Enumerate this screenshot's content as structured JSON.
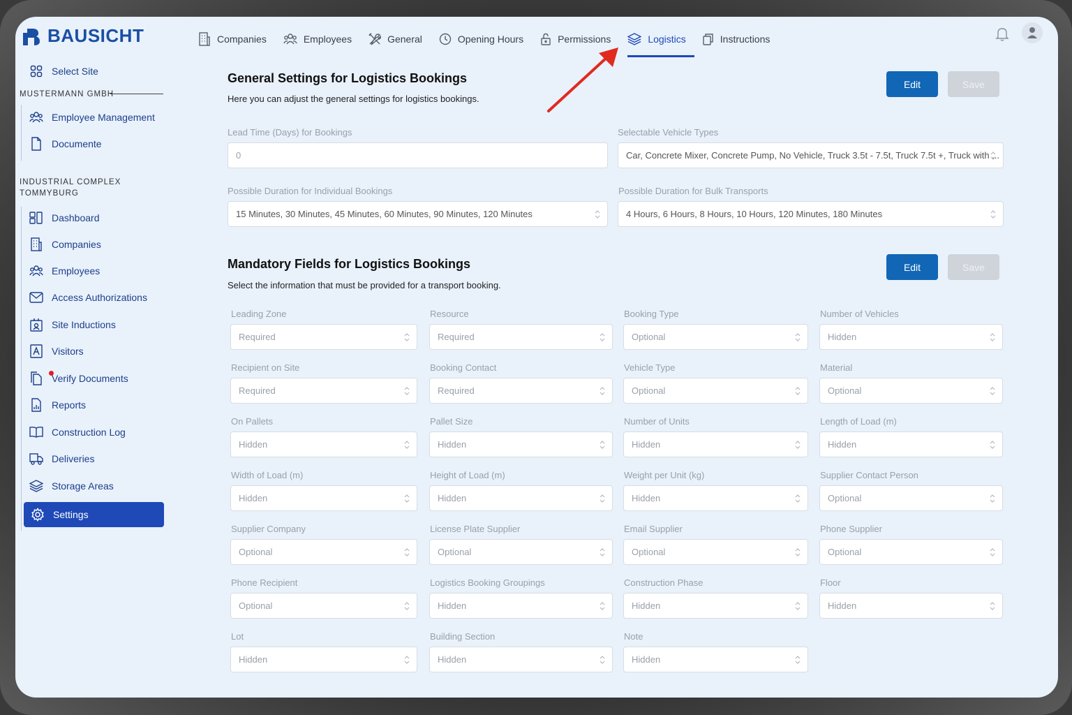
{
  "brand": {
    "name": "BAUSICHT",
    "color": "#1a4fa3"
  },
  "colors": {
    "accent": "#1e49b7",
    "primary_button": "#1166b5",
    "alert_dot": "#e11d2a"
  },
  "sidebar": {
    "select_site": "Select Site",
    "org_label": "MUSTERMANN GMBH",
    "org_items": [
      {
        "label": "Employee Management",
        "icon": "people-icon"
      },
      {
        "label": "Documente",
        "icon": "document-icon"
      }
    ],
    "site_label_1": "INDUSTRIAL COMPLEX",
    "site_label_2": "TOMMYBURG",
    "site_items": [
      {
        "label": "Dashboard",
        "icon": "dashboard-icon"
      },
      {
        "label": "Companies",
        "icon": "building-icon"
      },
      {
        "label": "Employees",
        "icon": "people-icon"
      },
      {
        "label": "Access Authorizations",
        "icon": "mail-icon"
      },
      {
        "label": "Site Inductions",
        "icon": "induction-icon"
      },
      {
        "label": "Visitors",
        "icon": "visitor-icon"
      },
      {
        "label": "Verify Documents",
        "icon": "documents-icon"
      },
      {
        "label": "Reports",
        "icon": "report-icon"
      },
      {
        "label": "Construction Log",
        "icon": "book-icon"
      },
      {
        "label": "Deliveries",
        "icon": "truck-icon"
      },
      {
        "label": "Storage Areas",
        "icon": "layers-icon"
      },
      {
        "label": "Settings",
        "icon": "gear-icon"
      }
    ]
  },
  "topnav": {
    "tabs": [
      {
        "label": "Companies",
        "icon": "building-icon"
      },
      {
        "label": "Employees",
        "icon": "people-icon"
      },
      {
        "label": "General",
        "icon": "tools-icon"
      },
      {
        "label": "Opening Hours",
        "icon": "clock-icon"
      },
      {
        "label": "Permissions",
        "icon": "lock-icon"
      },
      {
        "label": "Logistics",
        "icon": "layers-icon"
      },
      {
        "label": "Instructions",
        "icon": "clipboard-icon"
      }
    ],
    "active_tab": "Logistics"
  },
  "general_settings": {
    "title": "General Settings for Logistics Bookings",
    "subtitle": "Here you can adjust the general settings for logistics bookings.",
    "edit_label": "Edit",
    "save_label": "Save",
    "lead_time_label": "Lead Time (Days) for Bookings",
    "lead_time_value": "0",
    "vehicle_types_label": "Selectable Vehicle Types",
    "vehicle_types_value": "Car, Concrete Mixer, Concrete Pump, No Vehicle, Truck 3.5t - 7.5t, Truck 7.5t +, Truck with ...",
    "individual_label": "Possible Duration for Individual Bookings",
    "individual_value": "15 Minutes, 30 Minutes, 45 Minutes, 60 Minutes, 90 Minutes, 120 Minutes",
    "bulk_label": "Possible Duration for Bulk Transports",
    "bulk_value": "4 Hours, 6 Hours, 8 Hours, 10 Hours, 120 Minutes, 180 Minutes"
  },
  "mandatory_fields": {
    "title": "Mandatory Fields for Logistics Bookings",
    "subtitle": "Select the information that must be provided for a transport booking.",
    "edit_label": "Edit",
    "save_label": "Save",
    "fields": [
      {
        "label": "Leading Zone",
        "value": "Required"
      },
      {
        "label": "Resource",
        "value": "Required"
      },
      {
        "label": "Booking Type",
        "value": "Optional"
      },
      {
        "label": "Number of Vehicles",
        "value": "Hidden"
      },
      {
        "label": "Recipient on Site",
        "value": "Required"
      },
      {
        "label": "Booking Contact",
        "value": "Required"
      },
      {
        "label": "Vehicle Type",
        "value": "Optional"
      },
      {
        "label": "Material",
        "value": "Optional"
      },
      {
        "label": "On Pallets",
        "value": "Hidden"
      },
      {
        "label": "Pallet Size",
        "value": "Hidden"
      },
      {
        "label": "Number of Units",
        "value": "Hidden"
      },
      {
        "label": "Length of Load (m)",
        "value": "Hidden"
      },
      {
        "label": "Width of Load (m)",
        "value": "Hidden"
      },
      {
        "label": "Height of Load (m)",
        "value": "Hidden"
      },
      {
        "label": "Weight per Unit (kg)",
        "value": "Hidden"
      },
      {
        "label": "Supplier Contact Person",
        "value": "Optional"
      },
      {
        "label": "Supplier Company",
        "value": "Optional"
      },
      {
        "label": "License Plate Supplier",
        "value": "Optional"
      },
      {
        "label": "Email Supplier",
        "value": "Optional"
      },
      {
        "label": "Phone Supplier",
        "value": "Optional"
      },
      {
        "label": "Phone Recipient",
        "value": "Optional"
      },
      {
        "label": "Logistics Booking Groupings",
        "value": "Hidden"
      },
      {
        "label": "Construction Phase",
        "value": "Hidden"
      },
      {
        "label": "Floor",
        "value": "Hidden"
      },
      {
        "label": "Lot",
        "value": "Hidden"
      },
      {
        "label": "Building Section",
        "value": "Hidden"
      },
      {
        "label": "Note",
        "value": "Hidden"
      }
    ]
  }
}
